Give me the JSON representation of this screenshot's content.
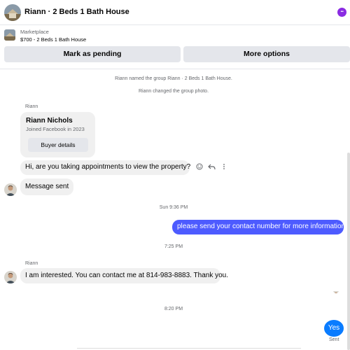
{
  "header": {
    "title": "Riann · 2 Beds 1 Bath House"
  },
  "listing": {
    "label": "Marketplace",
    "price_title": "$700 - 2 Beds 1 Bath House",
    "mark_pending_label": "Mark as pending",
    "more_options_label": "More options"
  },
  "thread": {
    "system_messages": [
      "Riann named the group Riann · 2 Beds 1 Bath House.",
      "Riann changed the group photo."
    ],
    "sender_name_1": "Riann",
    "card": {
      "name": "Riann Nichols",
      "joined": "Joined Facebook in 2023",
      "buyer_details_label": "Buyer details"
    },
    "msg_1": "Hi,  are you taking appointments to view the property?",
    "msg_2": "Message sent",
    "timestamp_1": "Sun 9:36 PM",
    "msg_3": "please send your contact number for more information",
    "timestamp_2": "7:25 PM",
    "sender_name_2": "Riann",
    "msg_4": "I am interested. You can contact me at 814-983-8883. Thank you.",
    "timestamp_3": "8:20 PM",
    "msg_5": "Yes",
    "sent_status": "Sent"
  },
  "icons": {
    "react": "smiley-icon",
    "reply": "reply-arrow-icon",
    "more": "vertical-dots-icon",
    "menu": "group-menu-icon"
  },
  "colors": {
    "outgoing_bubble": "#4d5bff",
    "sent_bubble": "#0a7cff",
    "incoming_bubble": "#f0f0f0",
    "menu_accent": "#8a2be2"
  }
}
